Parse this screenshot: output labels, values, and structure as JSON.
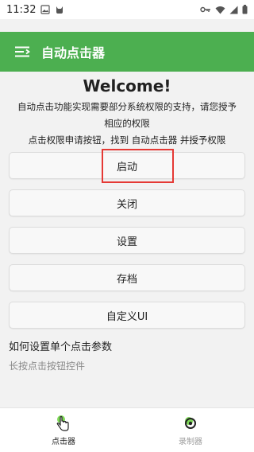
{
  "status_bar": {
    "time": "11:32",
    "icons": [
      "image-icon",
      "cat-icon",
      "key-icon",
      "wifi-icon",
      "signal-icon",
      "battery-icon"
    ]
  },
  "app_bar": {
    "title": "自动点击器",
    "menu_icon": "menu-icon",
    "background": "#4caf50"
  },
  "main": {
    "welcome": "Welcome!",
    "desc_line1": "自动点击功能实现需要部分系统权限的支持，请您授予",
    "desc_line2": "相应的权限",
    "desc_line3": "点击权限申请按钮，找到 自动点击器 并授予权限",
    "buttons": [
      {
        "label": "启动"
      },
      {
        "label": "关闭"
      },
      {
        "label": "设置"
      },
      {
        "label": "存档"
      },
      {
        "label": "自定义UI"
      }
    ],
    "section_title": "如何设置单个点击参数",
    "section_sub": "长按点击按钮控件"
  },
  "bottom_nav": {
    "items": [
      {
        "label": "点击器",
        "icon": "tap-hand-icon",
        "active": true
      },
      {
        "label": "录制器",
        "icon": "record-icon",
        "active": false
      }
    ]
  },
  "colors": {
    "accent": "#4caf50",
    "highlight": "#e53935"
  }
}
